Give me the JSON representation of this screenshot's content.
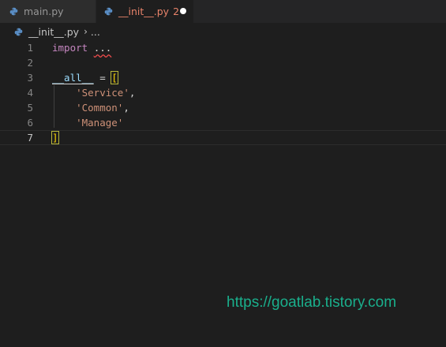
{
  "tabs": [
    {
      "label": "main.py",
      "icon": "python-icon",
      "active": false
    },
    {
      "label": "__init__.py",
      "badge": "2",
      "icon": "python-icon",
      "active": true,
      "dirty": true
    }
  ],
  "breadcrumb": {
    "file": "__init__.py",
    "separator": "›",
    "more": "..."
  },
  "editor": {
    "line_numbers": [
      "1",
      "2",
      "3",
      "4",
      "5",
      "6",
      "7"
    ],
    "active_line": "7",
    "tokens": {
      "import_kw": "import",
      "ellipsis": "...",
      "all_var": "__all__",
      "assign": " = ",
      "open_bracket": "[",
      "item1": "'Service'",
      "item2": "'Common'",
      "item3": "'Manage'",
      "comma": ",",
      "close_bracket": "]"
    }
  },
  "watermark": "https://goatlab.tistory.com",
  "colors": {
    "background": "#1e1e1e",
    "keyword": "#c586c0",
    "variable": "#9cdcfe",
    "string": "#ce9178",
    "error_tab": "#e8836a",
    "watermark": "#1aaf8c"
  }
}
